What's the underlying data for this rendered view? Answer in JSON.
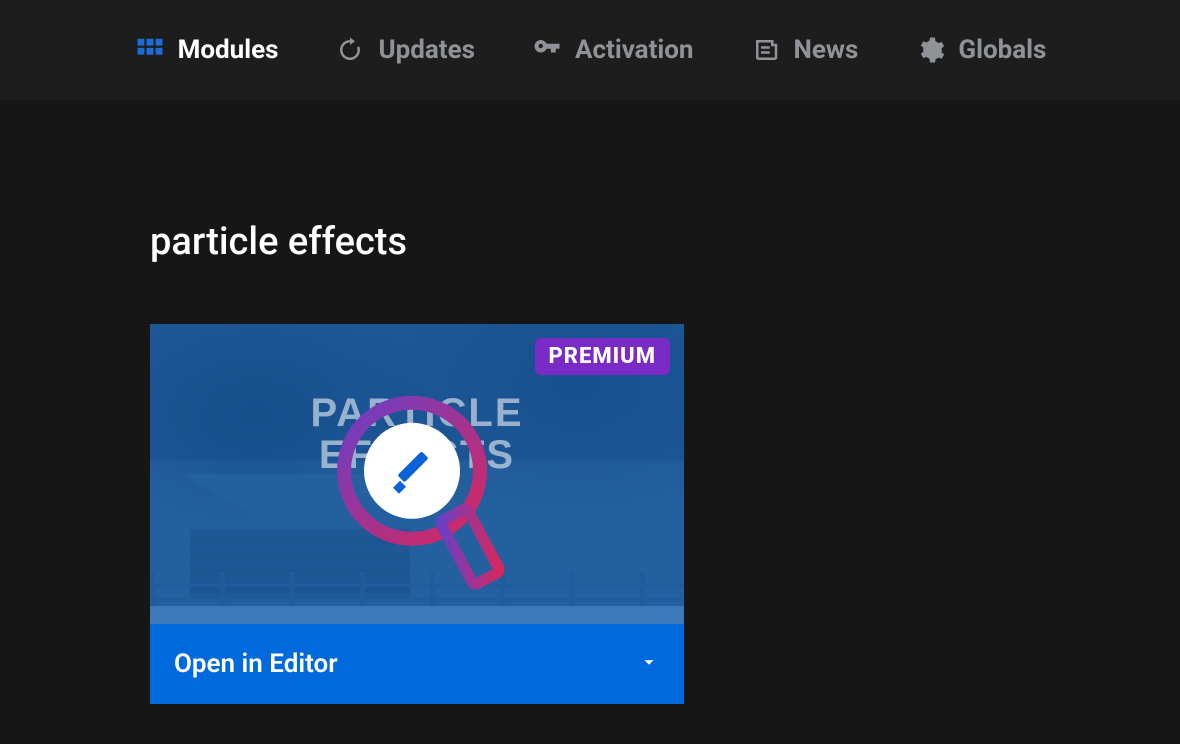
{
  "nav": {
    "modules": "Modules",
    "updates": "Updates",
    "activation": "Activation",
    "news": "News",
    "globals": "Globals"
  },
  "section": {
    "title": "particle effects"
  },
  "card": {
    "badge": "PREMIUM",
    "watermark_line1": "PARTICLE",
    "watermark_line2": "EFFECTS",
    "action_label": "Open in Editor"
  }
}
